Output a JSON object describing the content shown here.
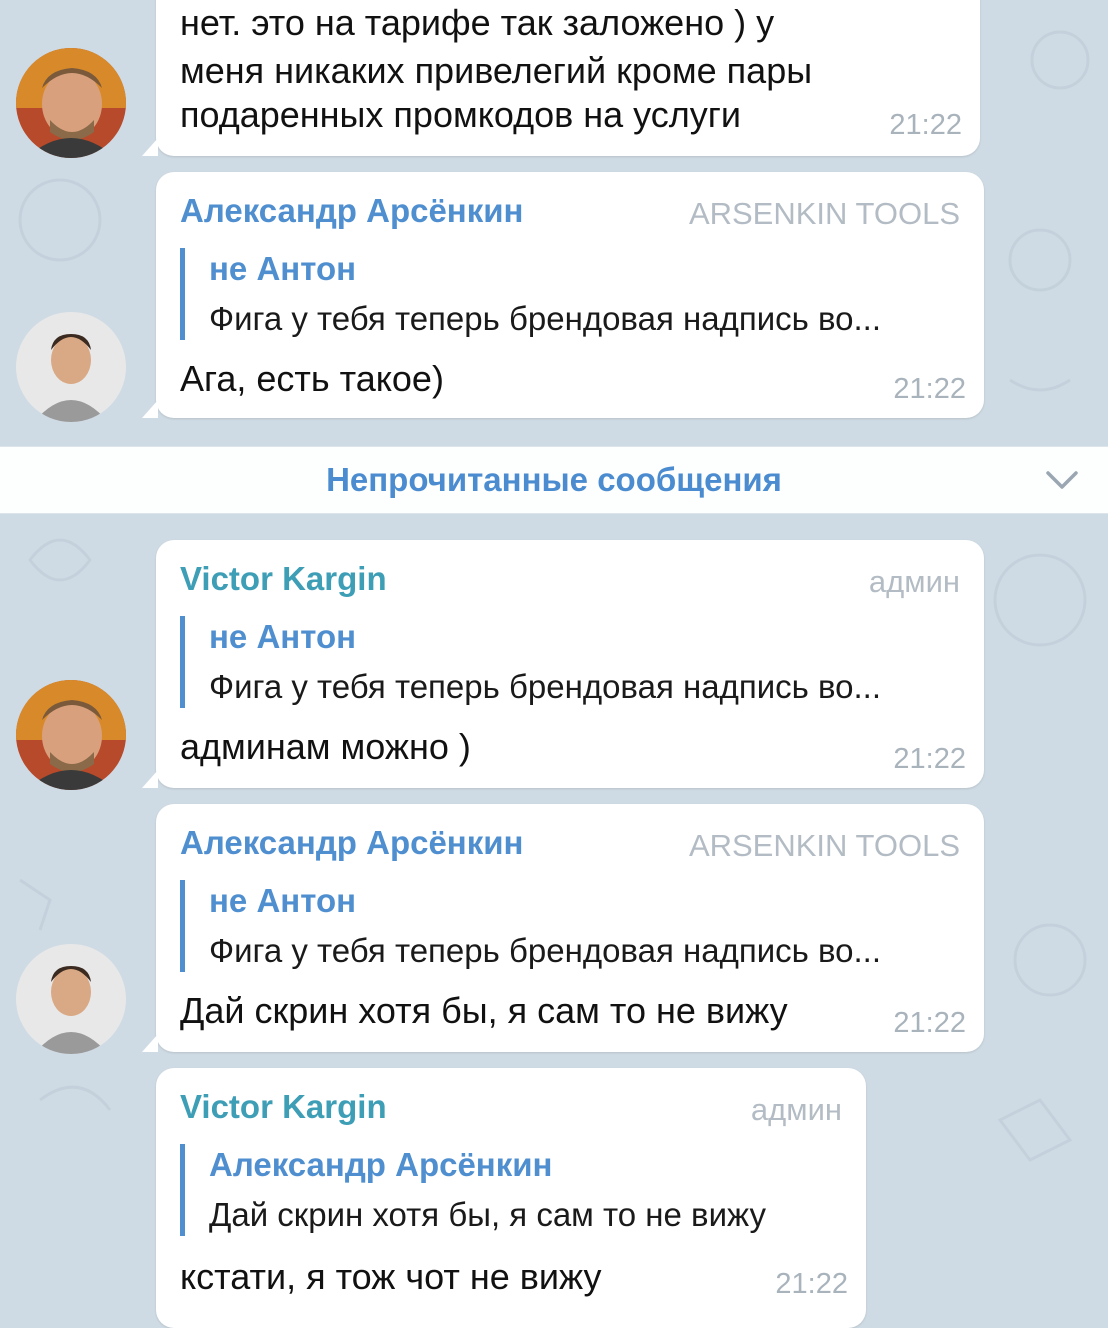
{
  "unread_divider": {
    "label": "Непрочитанные сообщения",
    "icon": "chevron-down-icon"
  },
  "messages": [
    {
      "lines": [
        "нет. это на тарифе так заложено ) у",
        "меня никаких привелегий кроме пары",
        "подаренных промкодов на услуги"
      ],
      "time": "21:22"
    },
    {
      "sender": "Александр Арсёнкин",
      "badge": "ARSENKIN TOOLS",
      "reply_name": "не Антон",
      "reply_text": "Фига у тебя теперь брендовая надпись во...",
      "text": "Ага, есть такое)",
      "time": "21:22"
    },
    {
      "sender": "Victor Kargin",
      "badge": "админ",
      "reply_name": "не Антон",
      "reply_text": "Фига у тебя теперь брендовая надпись во...",
      "text": "админам можно )",
      "time": "21:22"
    },
    {
      "sender": "Александр Арсёнкин",
      "badge": "ARSENKIN TOOLS",
      "reply_name": "не Антон",
      "reply_text": "Фига у тебя теперь брендовая надпись во...",
      "text": "Дай скрин хотя бы, я сам то не вижу",
      "time": "21:22"
    },
    {
      "sender": "Victor Kargin",
      "badge": "админ",
      "reply_name": "Александр Арсёнкин",
      "reply_text": "Дай скрин хотя бы, я сам то не вижу",
      "text": "кстати, я тож чот не вижу",
      "time": "21:22"
    }
  ],
  "colors": {
    "background": "#cfdbe4",
    "accent": "#4f8fd0",
    "victor_name": "#3d9eb6",
    "badge": "#b3bcc4"
  }
}
